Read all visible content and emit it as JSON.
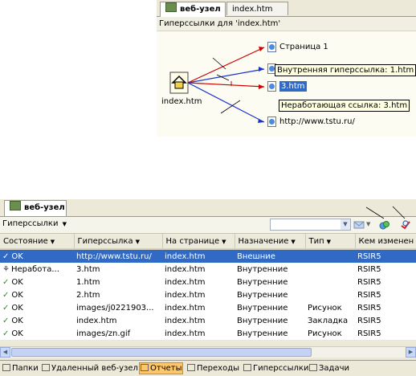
{
  "top_panel": {
    "tabs": [
      {
        "label": "веб-узел",
        "active": true
      },
      {
        "label": "index.htm",
        "active": false
      }
    ],
    "subheader": "Гиперссылки для 'index.htm'",
    "center_file": "index.htm",
    "links": [
      {
        "label": "Страница 1",
        "color": "#cc0000"
      },
      {
        "label": "3.htm",
        "color": "#cc0000",
        "selected": true
      },
      {
        "label": "http://www.tstu.ru/",
        "color": "#1a33cc"
      }
    ],
    "tooltips": {
      "internal": "Внутренняя гиперссылка: 1.htm",
      "broken": "Неработающая ссылка: 3.htm"
    }
  },
  "bottom_panel": {
    "tab_label": "веб-узел",
    "view_label": "Гиперссылки",
    "columns": [
      "Состояние",
      "Гиперссылка",
      "На странице",
      "Назначение",
      "Тип",
      "Кем изменен"
    ],
    "rows": [
      {
        "status": "OK",
        "status_icon": "check-icon",
        "link": "http://www.tstu.ru/",
        "page": "index.htm",
        "dest": "Внешние",
        "type": "",
        "by": "RSIR5",
        "selected": true
      },
      {
        "status": "Неработа...",
        "status_icon": "broken-link-icon",
        "link": "3.htm",
        "page": "index.htm",
        "dest": "Внутренние",
        "type": "",
        "by": "RSIR5"
      },
      {
        "status": "OK",
        "status_icon": "check-icon",
        "link": "1.htm",
        "page": "index.htm",
        "dest": "Внутренние",
        "type": "",
        "by": "RSIR5"
      },
      {
        "status": "OK",
        "status_icon": "check-icon",
        "link": "2.htm",
        "page": "index.htm",
        "dest": "Внутренние",
        "type": "",
        "by": "RSIR5"
      },
      {
        "status": "OK",
        "status_icon": "check-icon",
        "link": "images/j0221903...",
        "page": "index.htm",
        "dest": "Внутренние",
        "type": "Рисунок",
        "by": "RSIR5"
      },
      {
        "status": "OK",
        "status_icon": "check-icon",
        "link": "index.htm",
        "page": "index.htm",
        "dest": "Внутренние",
        "type": "Закладка",
        "by": "RSIR5"
      },
      {
        "status": "OK",
        "status_icon": "check-icon",
        "link": "images/zn.gif",
        "page": "index.htm",
        "dest": "Внутренние",
        "type": "Рисунок",
        "by": "RSIR5"
      }
    ],
    "views": [
      {
        "label": "Папки",
        "icon": "folders-icon"
      },
      {
        "label": "Удаленный веб-узел",
        "icon": "remote-site-icon"
      },
      {
        "label": "Отчеты",
        "icon": "reports-icon",
        "active": true
      },
      {
        "label": "Переходы",
        "icon": "navigation-icon"
      },
      {
        "label": "Гиперссылки",
        "icon": "hyperlinks-icon"
      },
      {
        "label": "Задачи",
        "icon": "tasks-icon"
      }
    ]
  }
}
